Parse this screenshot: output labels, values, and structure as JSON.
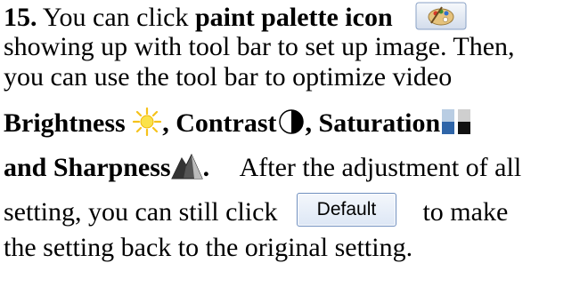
{
  "step": {
    "number": "15.",
    "intro": " You can click ",
    "palette_label": "paint palette icon",
    "line1_tail": "",
    "line2": "showing up with tool bar to set up image. Then,",
    "line3": "you can use the tool bar to optimize video",
    "brightness": "Brightness",
    "contrast": ", Contrast",
    "saturation": ", Saturation",
    "and_sharpness": "and Sharpness",
    "period": ".",
    "after_text": "After the adjustment of all",
    "setting_prefix": "setting, you can still click",
    "default_button": "Default",
    "to_make": "to make",
    "last_line": "the setting back to the original setting."
  },
  "icons": [
    "paint-palette-icon",
    "brightness-sun-icon",
    "contrast-icon",
    "saturation-icon",
    "sharpness-icon"
  ]
}
